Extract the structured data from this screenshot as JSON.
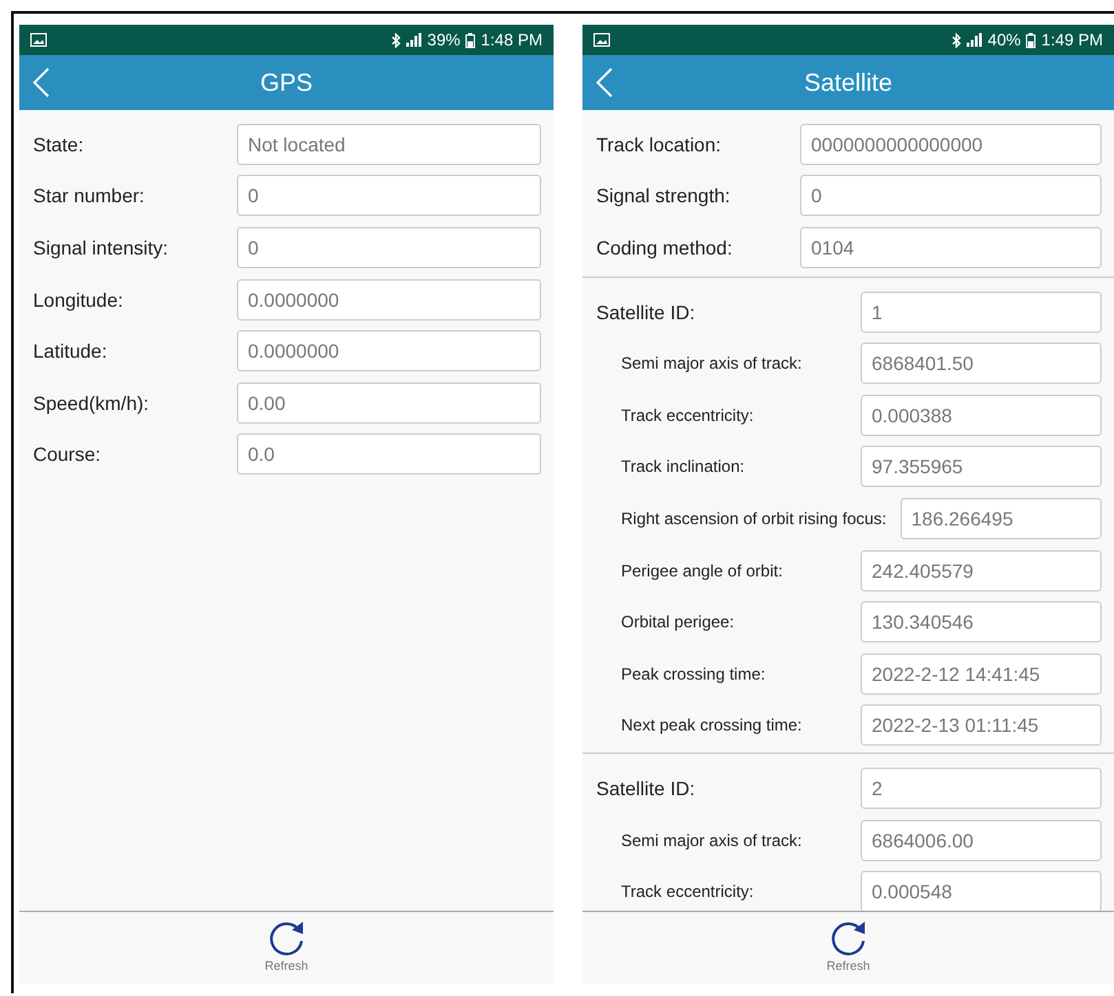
{
  "screens": [
    {
      "status_bar": {
        "battery": "39%",
        "time": "1:48 PM"
      },
      "title": "GPS",
      "fields": [
        {
          "label": "State:",
          "value": "Not located"
        },
        {
          "label": "Star number:",
          "value": "0"
        },
        {
          "label": "Signal intensity:",
          "value": "0"
        },
        {
          "label": "Longitude:",
          "value": "0.0000000"
        },
        {
          "label": "Latitude:",
          "value": "0.0000000"
        },
        {
          "label": "Speed(km/h):",
          "value": "0.00"
        },
        {
          "label": "Course:",
          "value": "0.0"
        }
      ],
      "bottom_button": "Refresh"
    },
    {
      "status_bar": {
        "battery": "40%",
        "time": "1:49 PM"
      },
      "title": "Satellite",
      "fields": [
        {
          "label": "Track location:",
          "value": "0000000000000000"
        },
        {
          "label": "Signal strength:",
          "value": "0"
        },
        {
          "label": "Coding method:",
          "value": "0104"
        }
      ],
      "satellites": [
        {
          "id_label": "Satellite ID:",
          "id_value": "1",
          "params": [
            {
              "label": "Semi major axis of track:",
              "value": "6868401.50"
            },
            {
              "label": "Track eccentricity:",
              "value": "0.000388"
            },
            {
              "label": "Track inclination:",
              "value": "97.355965"
            },
            {
              "label": "Right ascension of orbit rising focus:",
              "value": "186.266495"
            },
            {
              "label": "Perigee angle of orbit:",
              "value": "242.405579"
            },
            {
              "label": "Orbital perigee:",
              "value": "130.340546"
            },
            {
              "label": "Peak crossing time:",
              "value": "2022-2-12 14:41:45"
            },
            {
              "label": "Next peak crossing time:",
              "value": "2022-2-13 01:11:45"
            }
          ]
        },
        {
          "id_label": "Satellite ID:",
          "id_value": "2",
          "params": [
            {
              "label": "Semi major axis of track:",
              "value": "6864006.00"
            },
            {
              "label": "Track eccentricity:",
              "value": "0.000548"
            }
          ]
        }
      ],
      "bottom_button": "Refresh"
    }
  ]
}
